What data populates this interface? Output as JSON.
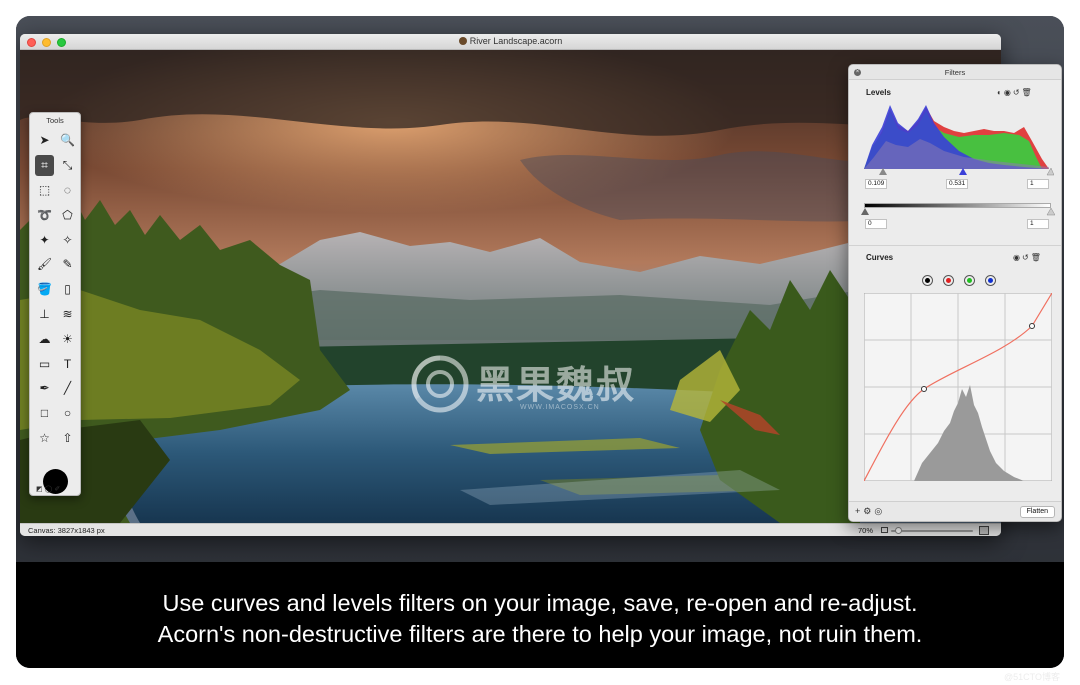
{
  "window": {
    "title": "River Landscape.acorn",
    "status_canvas": "Canvas: 3827x1843 px",
    "zoom": "70%"
  },
  "tools_palette": {
    "title": "Tools",
    "tools": [
      {
        "name": "arrow-select-tool",
        "glyph": "➤"
      },
      {
        "name": "zoom-tool",
        "glyph": "🔍"
      },
      {
        "name": "crop-tool",
        "glyph": "⌗",
        "active": true
      },
      {
        "name": "transform-tool",
        "glyph": "⤡"
      },
      {
        "name": "rect-marquee-tool",
        "glyph": "⬚"
      },
      {
        "name": "ellipse-marquee-tool",
        "glyph": "◌"
      },
      {
        "name": "lasso-tool",
        "glyph": "➰"
      },
      {
        "name": "polygon-lasso-tool",
        "glyph": "⬠"
      },
      {
        "name": "magic-wand-tool",
        "glyph": "✦"
      },
      {
        "name": "instant-alpha-tool",
        "glyph": "✧"
      },
      {
        "name": "brush-tool",
        "glyph": "🖌"
      },
      {
        "name": "pencil-tool",
        "glyph": "✎"
      },
      {
        "name": "paint-bucket-tool",
        "glyph": "🪣"
      },
      {
        "name": "eraser-tool",
        "glyph": "▯"
      },
      {
        "name": "clone-stamp-tool",
        "glyph": "⊥"
      },
      {
        "name": "smudge-tool",
        "glyph": "≋"
      },
      {
        "name": "cloud-shape-tool",
        "glyph": "☁"
      },
      {
        "name": "sun-shape-tool",
        "glyph": "☀"
      },
      {
        "name": "gradient-tool",
        "glyph": "▭"
      },
      {
        "name": "text-tool",
        "glyph": "T"
      },
      {
        "name": "pen-tool",
        "glyph": "✒"
      },
      {
        "name": "line-tool",
        "glyph": "╱"
      },
      {
        "name": "rectangle-tool",
        "glyph": "□"
      },
      {
        "name": "oval-tool",
        "glyph": "○"
      },
      {
        "name": "star-tool",
        "glyph": "☆"
      },
      {
        "name": "arrow-shape-tool",
        "glyph": "⇧"
      }
    ]
  },
  "filters_panel": {
    "title": "Filters",
    "levels": {
      "title": "Levels",
      "input_black": "0.109",
      "input_gamma": "0.531",
      "input_white": "1",
      "output_black": "0",
      "output_white": "1"
    },
    "curves": {
      "title": "Curves",
      "channels": [
        {
          "name": "composite",
          "color": "#000000"
        },
        {
          "name": "red",
          "color": "#e02020"
        },
        {
          "name": "green",
          "color": "#20c020"
        },
        {
          "name": "blue",
          "color": "#1030d0"
        }
      ]
    },
    "flatten_label": "Flatten"
  },
  "watermark": {
    "text": "黑果魏叔",
    "sub": "WWW.IMACOSX.CN"
  },
  "caption": {
    "line1": "Use curves and levels filters on your image, save, re-open and re-adjust.",
    "line2": "Acorn's non-destructive filters are there to help your image, not ruin them."
  },
  "corner_mark": "@51CTO博客",
  "colors": {
    "caption_bg": "#000000",
    "curve_line": "#f07060",
    "histogram_blue": "#3a3fd8",
    "histogram_green": "#48c040",
    "histogram_red": "#e04040"
  }
}
